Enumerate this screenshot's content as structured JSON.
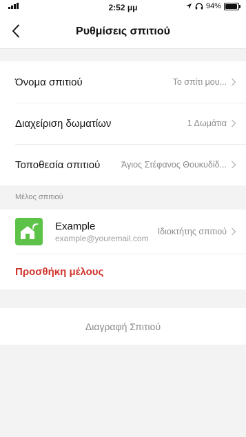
{
  "status_bar": {
    "time": "2:52 μμ",
    "battery": "94%",
    "battery_level": 0.94
  },
  "header": {
    "title": "Ρυθμίσεις σπιτιού",
    "back_icon": "chevron-left-icon"
  },
  "settings": [
    {
      "label": "Όνομα σπιτιού",
      "value": "Το σπίτι μου..."
    },
    {
      "label": "Διαχείριση δωματίων",
      "value": "1 Δωμάτια"
    },
    {
      "label": "Τοποθεσία σπιτιού",
      "value": "Άγιος Στέφανος Θουκυδίδ..."
    }
  ],
  "members_section": {
    "header": "Μέλος σπιτιού",
    "members": [
      {
        "name": "Example",
        "email": "example@youremail.com",
        "role": "Ιδιοκτήτης σπιτιού",
        "avatar_icon": "house-wifi-icon",
        "avatar_color": "#5cc348"
      }
    ],
    "add_member_label": "Προσθήκη μέλους",
    "add_member_color": "#d0342c"
  },
  "delete_home_label": "Διαγραφή Σπιτιού"
}
